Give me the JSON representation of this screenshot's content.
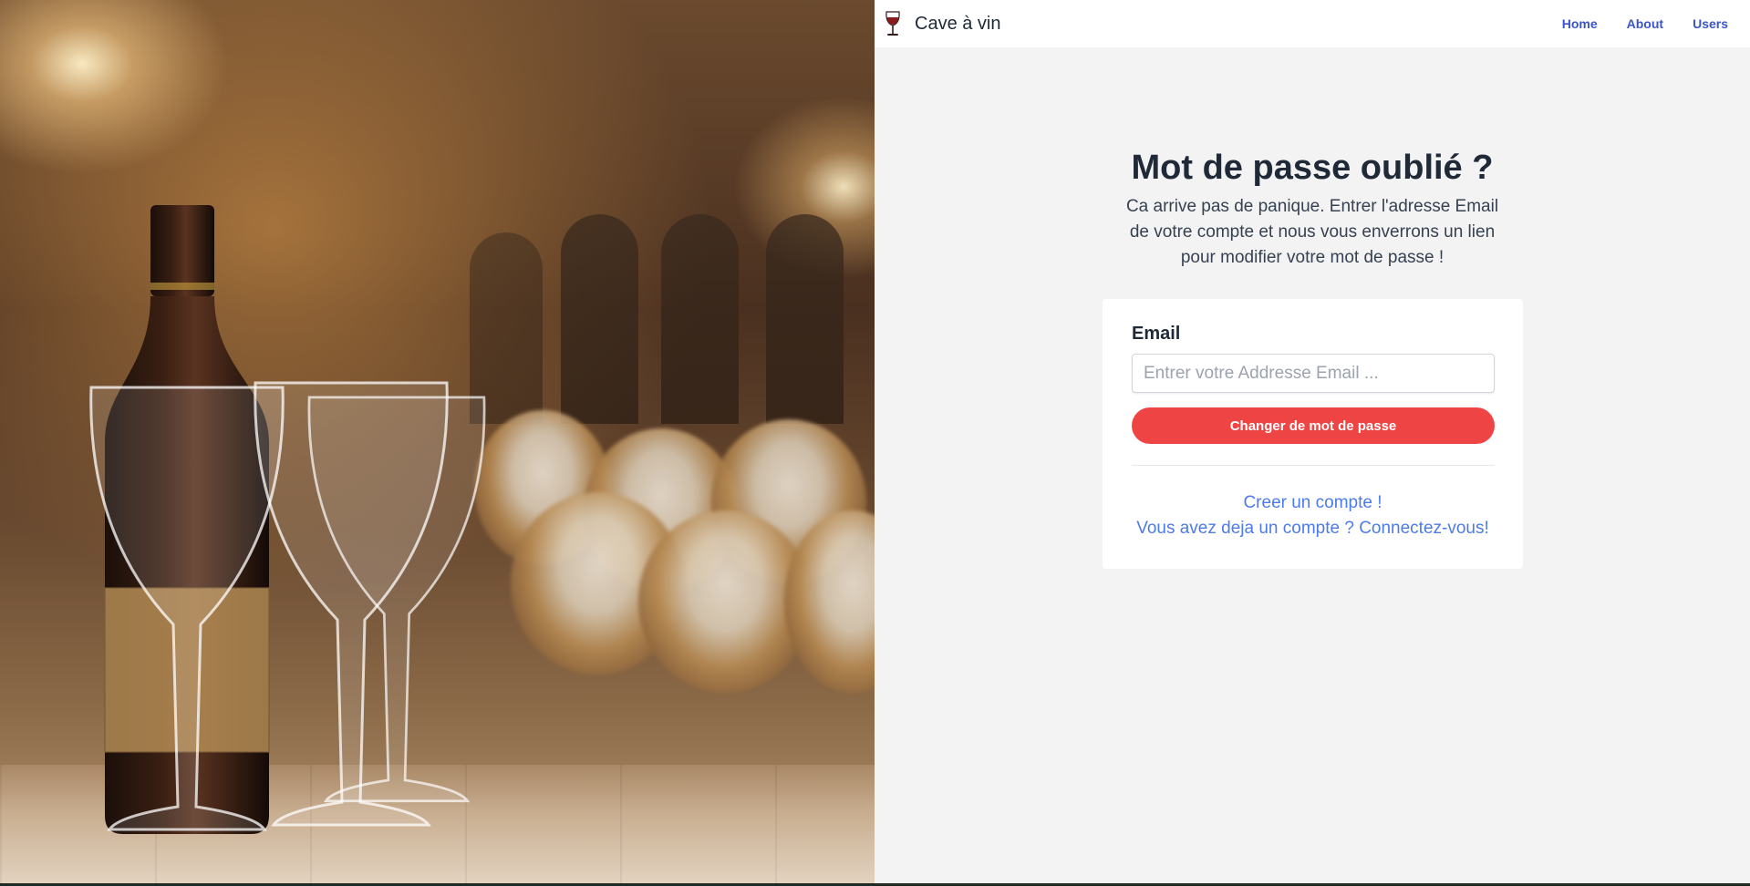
{
  "navbar": {
    "brand_icon": "wine-glass-icon",
    "brand": "Cave à vin",
    "links": [
      "Home",
      "About",
      "Users"
    ]
  },
  "main": {
    "title": "Mot de passe oublié ?",
    "subtitle": "Ca arrive pas de panique. Entrer l'adresse Email de votre compte et nous vous enverrons un lien pour modifier votre mot de passe !"
  },
  "form": {
    "email_label": "Email",
    "email_value": "",
    "email_placeholder": "Entrer votre Addresse Email ...",
    "submit_label": "Changer de mot de passe"
  },
  "links": {
    "register": "Creer un compte !",
    "login": "Vous avez deja un compte ? Connectez-vous!"
  },
  "hero": {
    "image": "wine-bottle-and-glasses-in-cellar-photo"
  },
  "colors": {
    "accent": "#ef4444",
    "nav_link": "#3b55c9",
    "link": "#4d7be8",
    "background": "#f3f3f3"
  }
}
